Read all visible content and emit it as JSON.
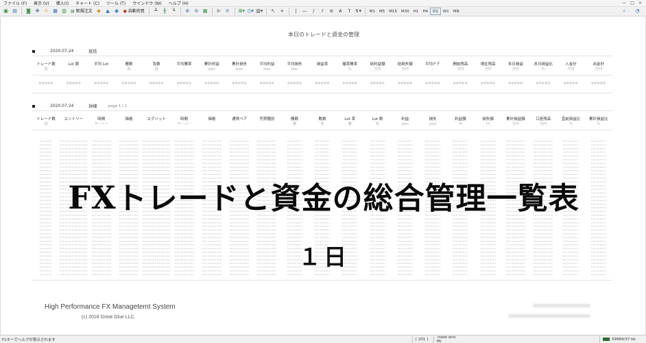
{
  "menubar": {
    "items": [
      "ファイル (F)",
      "表示 (V)",
      "挿入(I)",
      "チャート (C)",
      "ツール (T)",
      "ウインドウ (W)",
      "ヘルプ (H)"
    ],
    "window_controls": [
      "—",
      "□",
      "×"
    ]
  },
  "toolbar": {
    "new_order_label": "新規注文",
    "auto_trade_label": "自動売買",
    "timeframes": [
      "M1",
      "M5",
      "M15",
      "M30",
      "H1",
      "H4",
      "D1",
      "W1",
      "MN"
    ],
    "active_timeframe": "D1",
    "text_tool": "A",
    "text_label_tool": "T",
    "icons": [
      "new-chart-icon",
      "save-icon",
      "market-watch-icon",
      "navigator-icon",
      "zoom-in-icon",
      "zoom-out-icon",
      "cursor-icon",
      "crosshair-icon",
      "search-icon"
    ]
  },
  "page": {
    "title": "本日のトレードと資金の管理"
  },
  "summary": {
    "date": "2020.07.24",
    "label": "総括",
    "columns": [
      {
        "label": "トレード数",
        "unit": "回"
      },
      {
        "label": "Lot 数",
        "unit": "--"
      },
      {
        "label": "平均 Lot",
        "unit": "--"
      },
      {
        "label": "勝数",
        "unit": "回"
      },
      {
        "label": "負数",
        "unit": "回"
      },
      {
        "label": "平均勝率",
        "unit": "--"
      },
      {
        "label": "累計利益",
        "unit": "pips"
      },
      {
        "label": "累計損失",
        "unit": "pips"
      },
      {
        "label": "平均利益",
        "unit": "pips"
      },
      {
        "label": "平均損失",
        "unit": "pips"
      },
      {
        "label": "損益率",
        "unit": "--"
      },
      {
        "label": "確率勝率",
        "unit": "%"
      },
      {
        "label": "総利益額",
        "unit": "万円"
      },
      {
        "label": "総損失額",
        "unit": "万円"
      },
      {
        "label": "平均ＰＦ",
        "unit": "--"
      },
      {
        "label": "開始残高",
        "unit": "万円"
      },
      {
        "label": "現在残高",
        "unit": "万円"
      },
      {
        "label": "本日損益",
        "unit": "万円"
      },
      {
        "label": "本日損益比",
        "unit": "%"
      },
      {
        "label": "入金計",
        "unit": "万円"
      },
      {
        "label": "出金計",
        "unit": "万円"
      }
    ]
  },
  "detail": {
    "date": "2020.07.24",
    "label": "詳細",
    "page": "page  1 / 1",
    "columns": [
      {
        "label": "トレード数",
        "unit": "回"
      },
      {
        "label": "エントリー",
        "unit": ""
      },
      {
        "label": "時間",
        "unit": "サーバー"
      },
      {
        "label": "価格",
        "unit": ""
      },
      {
        "label": "エグジット",
        "unit": ""
      },
      {
        "label": "時間",
        "unit": "サーバー"
      },
      {
        "label": "価格",
        "unit": ""
      },
      {
        "label": "通貨ペア",
        "unit": ""
      },
      {
        "label": "売買種別",
        "unit": ""
      },
      {
        "label": "勝数",
        "unit": "勝"
      },
      {
        "label": "敗数",
        "unit": "負"
      },
      {
        "label": "Lot 率",
        "unit": "勝"
      },
      {
        "label": "Lot 数",
        "unit": "負"
      },
      {
        "label": "利益",
        "unit": "pips"
      },
      {
        "label": "損失",
        "unit": "pips"
      },
      {
        "label": "利益額",
        "unit": "円"
      },
      {
        "label": "損失額",
        "unit": "円"
      },
      {
        "label": "累計損益額",
        "unit": "万円"
      },
      {
        "label": "口座残高",
        "unit": "万円"
      },
      {
        "label": "直前損益比",
        "unit": "%"
      },
      {
        "label": "累計損益比",
        "unit": "%"
      }
    ]
  },
  "overlay": {
    "title_fx": "FX",
    "title_rest": "トレードと資金の総合管理一覧表",
    "subtitle": "１日"
  },
  "footer": {
    "system_name": "High Performance FX Managetemt System",
    "copyright": "(c) 2018   Great Glue LLC."
  },
  "statusbar": {
    "help_text": "F1キーでヘルプが表示されます",
    "seg1": "[ 201 ]",
    "seg2": "Trade and Mi",
    "memory": "59984/37 kb"
  }
}
